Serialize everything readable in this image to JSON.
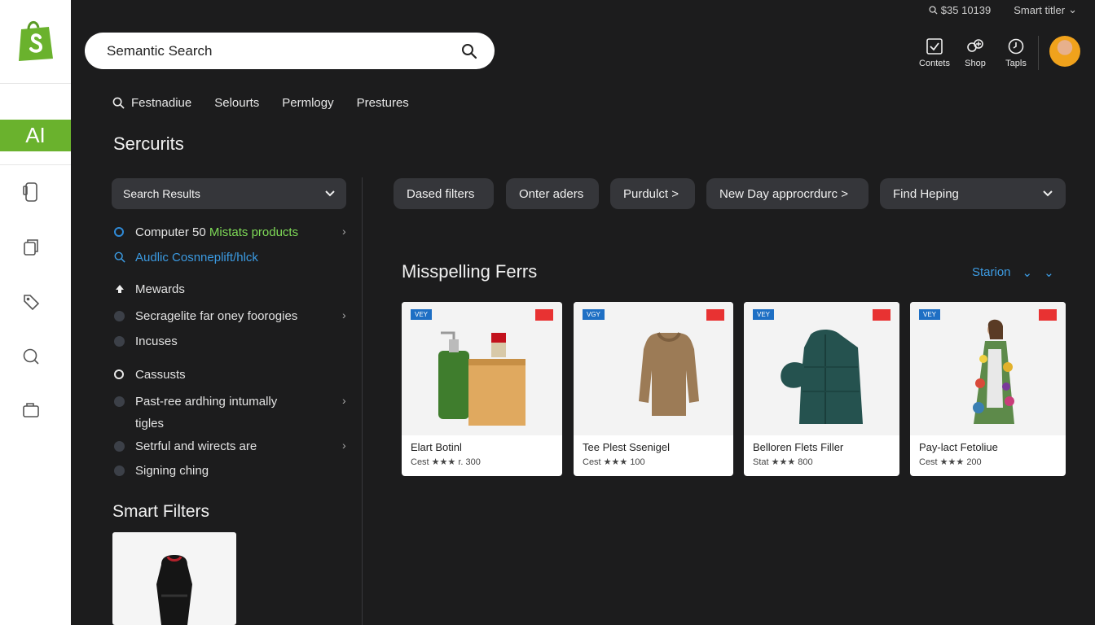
{
  "brand": {
    "accent": "#6ab22d",
    "ai_badge": "AI"
  },
  "search": {
    "placeholder": "Semantic Search"
  },
  "topline": {
    "left": "$35 10139",
    "right": "Smart titler"
  },
  "top_actions": [
    {
      "label": "Contets",
      "icon": "checklist-icon"
    },
    {
      "label": "Shop",
      "icon": "shop-icon"
    },
    {
      "label": "Tapls",
      "icon": "clock-icon"
    }
  ],
  "nav_tabs": [
    "Festnadiue",
    "Selourts",
    "Permlogy",
    "Prestures"
  ],
  "sidebar_section_title": "Sercurits",
  "results_select": "Search Results",
  "list": [
    {
      "prefix": "Computer 50 ",
      "highlight": "Mistats products"
    },
    {
      "text": "Audlic Cosnneplift/hlck"
    },
    {
      "text": "Mewards"
    },
    {
      "text": "Secragelite far oney foorogies"
    },
    {
      "text": "Incuses"
    },
    {
      "text": "Cassusts"
    },
    {
      "text": "Past-ree ardhing intumally tigles"
    },
    {
      "text": "Setrful and wirects are"
    },
    {
      "text": "Signing ching"
    }
  ],
  "smart_filters_title": "Smart Filters",
  "filter_chips": [
    "Dased filters",
    "Onter aders",
    "Purdulct >",
    "New Day approcrdurc >",
    "Find Heping"
  ],
  "results_title": "Misspelling Ferrs",
  "sort_label": "Starion",
  "products": [
    {
      "tag": "VEY",
      "name": "Elart Botinl",
      "meta": "Cest ★★★ r. 300"
    },
    {
      "tag": "VGY",
      "name": "Tee Plest Ssenigel",
      "meta": "Cest ★★★ 100"
    },
    {
      "tag": "VEY",
      "name": "Belloren Flets Filler",
      "meta": "Stat ★★★ 800"
    },
    {
      "tag": "VEY",
      "name": "Pay-lact Fetoliue",
      "meta": "Cest ★★★ 200"
    }
  ]
}
